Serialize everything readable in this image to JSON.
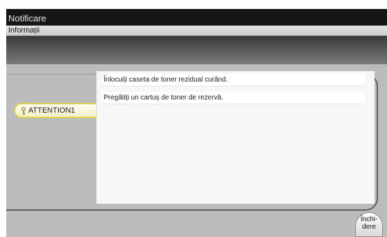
{
  "window": {
    "title": "Notificare",
    "subtitle": "Informații"
  },
  "attention_tab": {
    "label": "ATTENTION1",
    "icon": "key-icon",
    "color": "#e0d146"
  },
  "messages": [
    "Înlocuiți caseta de toner rezidual curând.",
    "Pregătiți un cartuș de toner de rezervă."
  ],
  "close_button": {
    "label": "Închi-\ndere"
  }
}
